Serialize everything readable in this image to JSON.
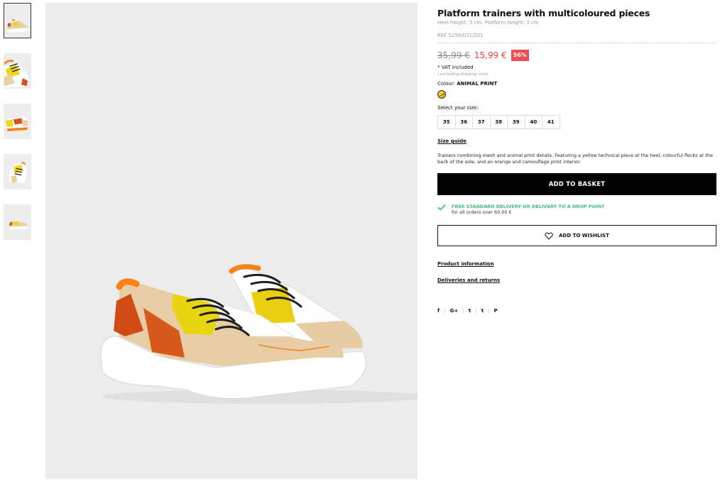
{
  "product": {
    "title": "Platform trainers with multicoloured pieces",
    "subtitle": "Heel height: 5 cm. Platform height: 3 cm.",
    "ref": "REF 5256/031/201"
  },
  "price": {
    "old": "35,99 €",
    "new": "15,99 €",
    "discount": "56%",
    "vat": "* VAT included",
    "shipping_note": "/ excluding shipping costs"
  },
  "colour": {
    "label": "Colour:",
    "value": "ANIMAL PRINT",
    "swatch_colour": "#e6bb2a"
  },
  "sizes": {
    "label": "Select your size:",
    "options": [
      "35",
      "36",
      "37",
      "38",
      "39",
      "40",
      "41"
    ],
    "guide_label": "Size guide"
  },
  "description": "Trainers combining mesh and animal print details. Featuring a yellow technical piece at the heel, colourful flecks at the back of the sole, and an orange and camouflage print interior.",
  "actions": {
    "add_to_basket": "ADD TO BASKET",
    "add_to_wishlist": "ADD TO WISHLIST"
  },
  "delivery": {
    "title": "FREE STANDARD DELIVERY OR DELIVERY TO A DROP POINT",
    "subtitle": "for all orders over 60,00 €",
    "accent_colour": "#3fbf7f"
  },
  "links": {
    "product_info": "Product information",
    "deliveries": "Deliveries and returns"
  },
  "social": {
    "facebook": "f",
    "googleplus": "G+",
    "twitter": "t",
    "tumblr": "t",
    "pinterest": "P"
  },
  "colours": {
    "price_red": "#e4434b",
    "discount_bg": "#ee4b54",
    "button_bg": "#000000",
    "image_bg": "#ececec"
  },
  "gallery": {
    "thumbnail_count": 5,
    "selected_thumbnail": 1
  }
}
